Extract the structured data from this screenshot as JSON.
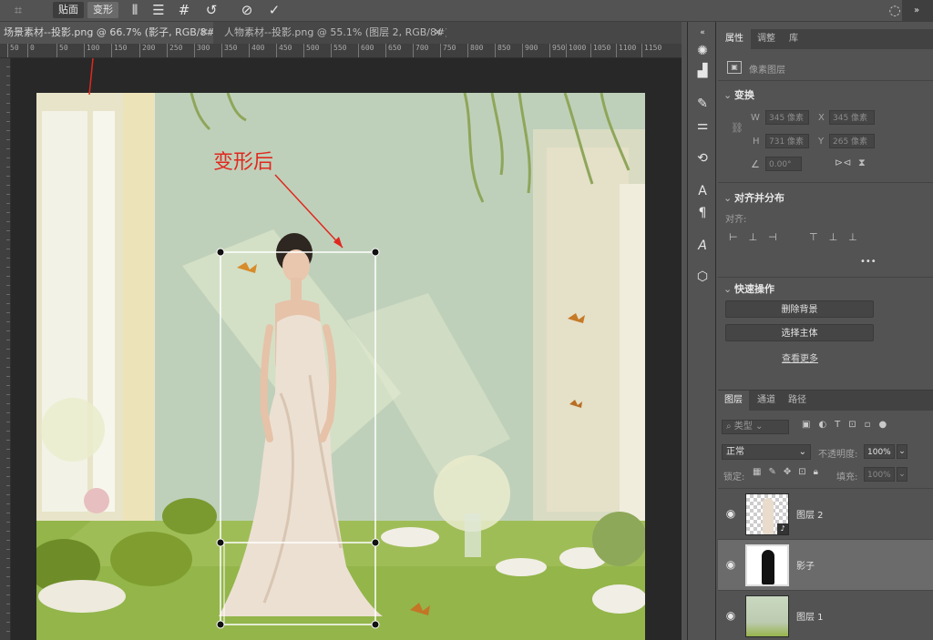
{
  "options_bar": {
    "button_a": "贴面",
    "button_b": "变形"
  },
  "tabs": [
    {
      "label": "场景素材--投影.png @ 66.7% (影子, RGB/8#) *",
      "active": true
    },
    {
      "label": "人物素材--投影.png @ 55.1% (图层 2, RGB/8#) *",
      "active": false
    }
  ],
  "ruler_ticks": [
    "50",
    "0",
    "50",
    "100",
    "150",
    "200",
    "250",
    "300",
    "350",
    "400",
    "450",
    "500",
    "550",
    "600",
    "650",
    "700",
    "750",
    "800",
    "850",
    "900",
    "950",
    "1000",
    "1050",
    "1100",
    "1150"
  ],
  "canvas": {
    "annotation": "变形后",
    "colors": {
      "annotation": "#e0281f",
      "wall": "#bfd0ba",
      "grass": "#93b54a",
      "dress": "#ece0d3"
    }
  },
  "properties": {
    "tabs": [
      "属性",
      "调整",
      "库"
    ],
    "layer_kind": "像素图层",
    "transform": {
      "title": "变换",
      "w_label": "W",
      "w_value": "345 像素",
      "x_label": "X",
      "x_value": "345 像素",
      "h_label": "H",
      "h_value": "731 像素",
      "y_label": "Y",
      "y_value": "265 像素",
      "angle_value": "0.00°"
    },
    "align": {
      "title": "对齐并分布",
      "align_to": "对齐:",
      "more": "•••"
    },
    "quick_actions": {
      "title": "快速操作",
      "remove_bg": "删除背景",
      "select_subject": "选择主体",
      "view_more": "查看更多"
    }
  },
  "layers_panel": {
    "tabs": [
      "图层",
      "通道",
      "路径"
    ],
    "filter_kind": "类型",
    "blend_mode": "正常",
    "opacity_label": "不透明度:",
    "opacity_value": "100%",
    "lock_label": "锁定:",
    "fill_label": "填充:",
    "fill_value": "100%",
    "layers": [
      {
        "name": "图层 2",
        "selected": false
      },
      {
        "name": "影子",
        "selected": true
      },
      {
        "name": "图层 1",
        "selected": false
      }
    ]
  }
}
